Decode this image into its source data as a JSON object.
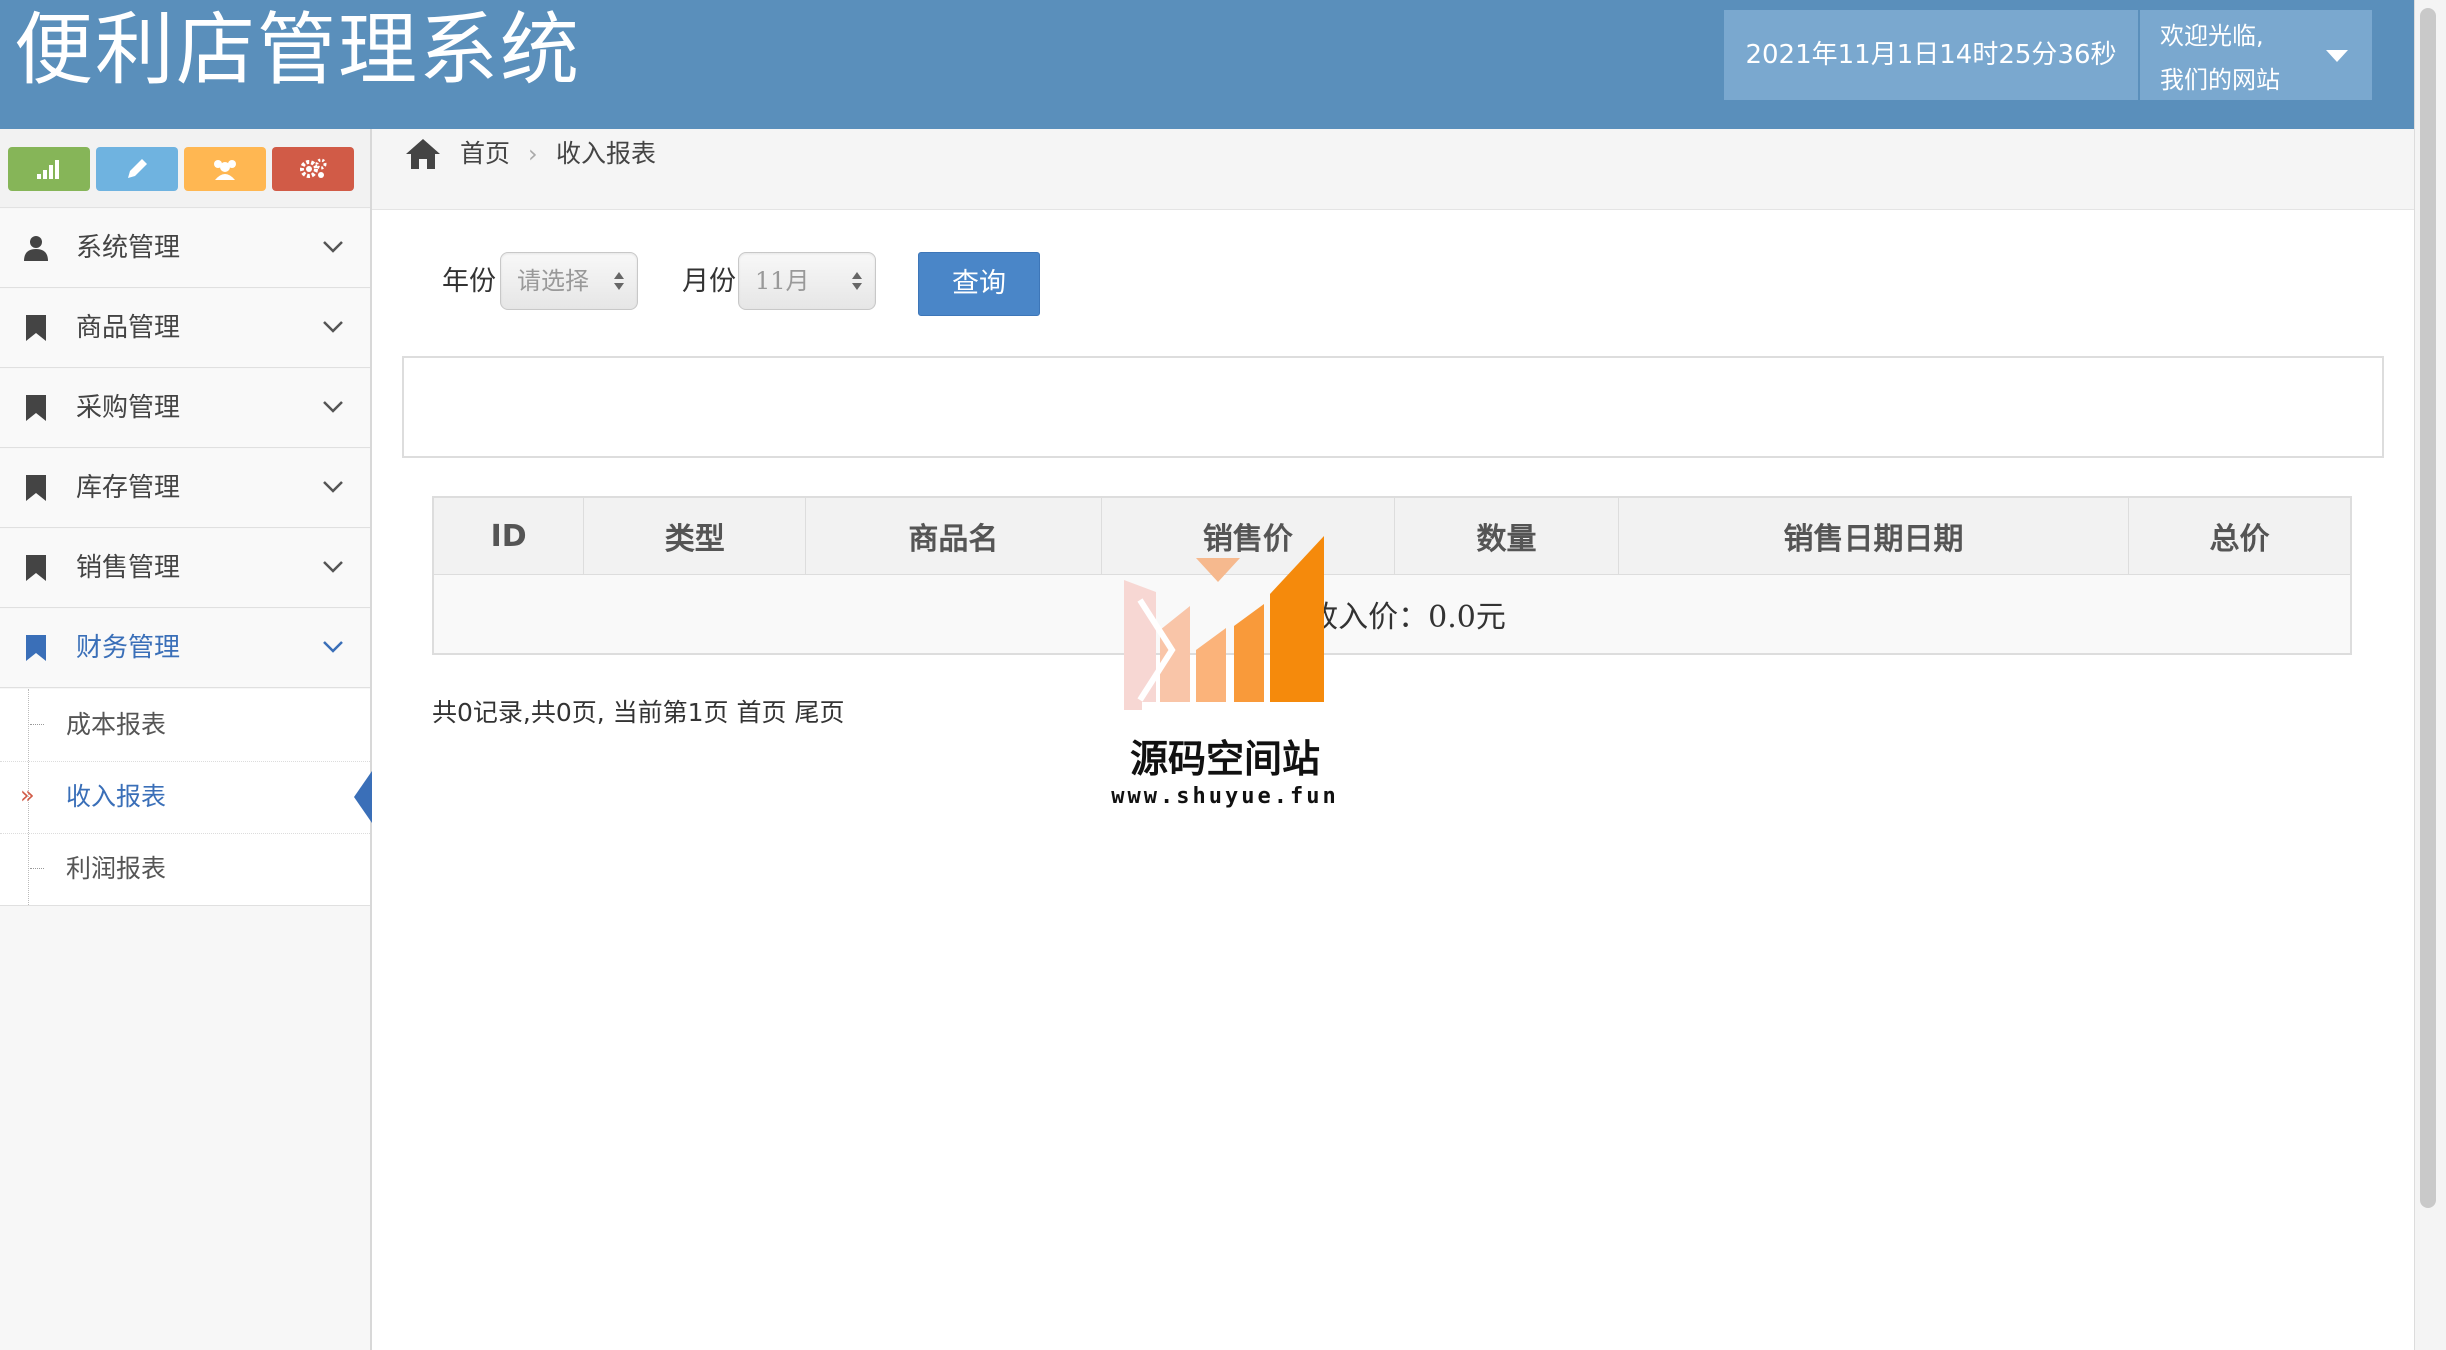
{
  "header": {
    "title": "便利店管理系统",
    "datetime": "2021年11月1日14时25分36秒",
    "user_line1": "欢迎光临,",
    "user_line2": "我们的网站"
  },
  "shortcuts": [
    {
      "icon": "signal-icon",
      "color": "#86b558"
    },
    {
      "icon": "pencil-icon",
      "color": "#6fb3e0"
    },
    {
      "icon": "users-icon",
      "color": "#ffb752"
    },
    {
      "icon": "cogs-icon",
      "color": "#d15b47"
    }
  ],
  "sidebar": {
    "items": [
      {
        "label": "系统管理",
        "icon": "user-icon"
      },
      {
        "label": "商品管理",
        "icon": "bookmark-icon"
      },
      {
        "label": "采购管理",
        "icon": "bookmark-icon"
      },
      {
        "label": "库存管理",
        "icon": "bookmark-icon"
      },
      {
        "label": "销售管理",
        "icon": "bookmark-icon"
      },
      {
        "label": "财务管理",
        "icon": "bookmark-icon",
        "active": true
      }
    ],
    "subitems": [
      {
        "label": "成本报表"
      },
      {
        "label": "收入报表",
        "active": true
      },
      {
        "label": "利润报表"
      }
    ]
  },
  "breadcrumb": {
    "home": "首页",
    "current": "收入报表"
  },
  "filters": {
    "year_label": "年份",
    "year_value": "请选择",
    "month_label": "月份",
    "month_value": "11月",
    "query_label": "查询"
  },
  "table": {
    "columns": [
      "ID",
      "类型",
      "商品名",
      "销售价",
      "数量",
      "销售日期日期",
      "总价"
    ],
    "summary": "总收入价：0.0元"
  },
  "pager": {
    "text": "共0记录,共0页, 当前第1页 首页 尾页"
  },
  "watermark": {
    "name": "源码空间站",
    "url": "www.shuyue.fun"
  },
  "colors": {
    "header_bg": "#5a8fbb",
    "accent": "#3a6fb8",
    "query_button": "#4a86c8"
  }
}
